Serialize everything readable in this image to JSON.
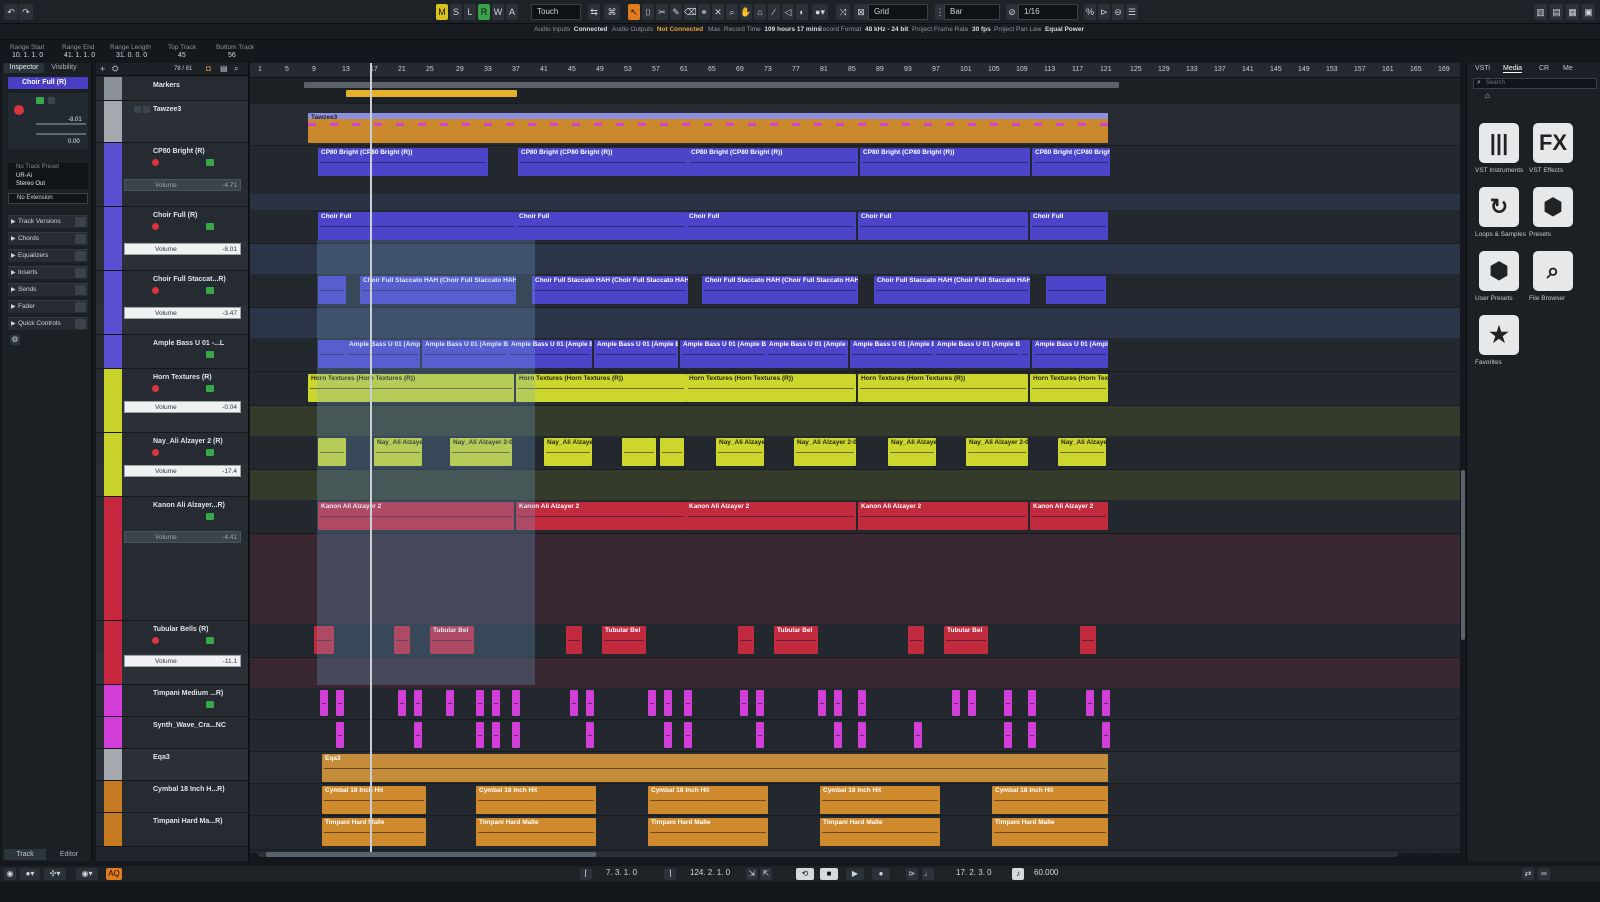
{
  "toolbar": {
    "btn_m": "M",
    "btn_s": "S",
    "btn_l": "L",
    "btn_r": "R",
    "btn_w": "W",
    "btn_a": "A",
    "automation_mode": "Touch",
    "snap_type": "Grid",
    "grid_type": "Bar",
    "quantize": "1/16"
  },
  "info": [
    {
      "label": "Audio Inputs",
      "value": "Connected",
      "warn": false
    },
    {
      "label": "Audio Outputs",
      "value": "Not Connected",
      "warn": true
    },
    {
      "label": "Max. Record Time",
      "value": "109 hours 17 mins",
      "warn": false
    },
    {
      "label": "Record Format",
      "value": "48 kHz - 24 bit",
      "warn": false
    },
    {
      "label": "Project Frame Rate",
      "value": "30 fps",
      "warn": false
    },
    {
      "label": "Project Pan Law",
      "value": "Equal Power",
      "warn": false
    }
  ],
  "range": {
    "start_label": "Range Start",
    "start": "10. 1. 1. 0",
    "end_label": "Range End",
    "end": "41. 1. 1. 0",
    "length_label": "Range Length",
    "length": "31. 0. 0. 0",
    "top_label": "Top Track",
    "top": "45",
    "bottom_label": "Bottom Track",
    "bottom": "56"
  },
  "inspector": {
    "tab_inspector": "Inspector",
    "tab_visibility": "Visibility",
    "track_name": "Choir Full (R)",
    "value1": "-8.01",
    "value2": "0.00",
    "no_preset": "No Track Preset",
    "input": "UR-Ai",
    "output": "Stereo Out",
    "extension": "No Extension",
    "sections": [
      "Track Versions",
      "Chords",
      "Equalizers",
      "Inserts",
      "Sends",
      "Fader",
      "Quick Controls"
    ]
  },
  "tracklist": {
    "count": "78 / 81",
    "tracks": [
      {
        "name": "Markers",
        "sub": "",
        "vol": ""
      },
      {
        "name": "Tawzee3",
        "sub": "",
        "vol": ""
      },
      {
        "name": "CP80 Bright (R)",
        "sub": "Volume",
        "vol": "-4.71"
      },
      {
        "name": "Choir Full (R)",
        "sub": "Volume",
        "vol": "-8.01"
      },
      {
        "name": "Choir Full Staccat...R)",
        "sub": "Volume",
        "vol": "-3.47"
      },
      {
        "name": "Ample Bass U 01 -...L",
        "sub": "",
        "vol": ""
      },
      {
        "name": "Horn Textures (R)",
        "sub": "Volume",
        "vol": "-0.04"
      },
      {
        "name": "Nay_Ali Alzayer 2 (R)",
        "sub": "Volume",
        "vol": "-17.4"
      },
      {
        "name": "Kanon Ali Alzayer...R)",
        "sub": "Volume",
        "vol": "-4.41"
      },
      {
        "name": "Tubular Bells (R)",
        "sub": "Volume",
        "vol": "-11.1"
      },
      {
        "name": "Timpani Medium ...R)",
        "sub": "",
        "vol": ""
      },
      {
        "name": "Synth_Wave_Cra...NC",
        "sub": "",
        "vol": ""
      },
      {
        "name": "Eqa3",
        "sub": "",
        "vol": ""
      },
      {
        "name": "Cymbal 18 Inch H...R)",
        "sub": "",
        "vol": ""
      },
      {
        "name": "Timpani Hard Ma...R)",
        "sub": "",
        "vol": ""
      }
    ]
  },
  "ruler": [
    "1",
    "5",
    "9",
    "13",
    "17",
    "21",
    "25",
    "29",
    "33",
    "37",
    "41",
    "45",
    "49",
    "53",
    "57",
    "61",
    "65",
    "69",
    "73",
    "77",
    "81",
    "85",
    "89",
    "93",
    "97",
    "101",
    "105",
    "109",
    "113",
    "117",
    "121",
    "125",
    "129",
    "133",
    "137",
    "141",
    "145",
    "149",
    "153",
    "157",
    "161",
    "165",
    "169"
  ],
  "events": {
    "tawzee": "Tawzee3",
    "cp80": "CP80 Bright (CP80 Bright (R))",
    "choir": "Choir Full",
    "choir_stacc": "Choir Full Staccato HAH (Choir Full Staccato HAH (R))",
    "bass": "Ample Bass U 01 (Ample Bass",
    "horn": "Horn Textures (Horn Textures (R))",
    "nay": "Nay_Ali Alzayer 2-01",
    "kanon": "Kanon Ali Alzayer 2",
    "bells": "Tubular Bel",
    "eqa": "Eqa3",
    "cymbal": "Cymbal 18 Inch Hit",
    "timpani": "Timpani Hard Malle"
  },
  "rightpanel": {
    "tabs": [
      "VSTi",
      "Media",
      "CR",
      "Me"
    ],
    "search_placeholder": "Search",
    "items": [
      {
        "label": "VST Instruments",
        "icon": "piano-icon",
        "glyph": "|||"
      },
      {
        "label": "VST Effects",
        "icon": "fx-icon",
        "glyph": "FX"
      },
      {
        "label": "Loops & Samples",
        "icon": "loop-icon",
        "glyph": "↻"
      },
      {
        "label": "Presets",
        "icon": "presets-icon",
        "glyph": "⬢"
      },
      {
        "label": "User Presets",
        "icon": "user-presets-icon",
        "glyph": "⬢"
      },
      {
        "label": "File Browser",
        "icon": "file-browser-icon",
        "glyph": "⌕"
      },
      {
        "label": "Favorites",
        "icon": "star-icon",
        "glyph": "★"
      }
    ]
  },
  "transport": {
    "left_locator": "7. 3. 1. 0",
    "right_locator": "124. 2. 1. 0",
    "position": "17. 2. 3. 0",
    "tempo": "60.000",
    "track_tab": "Track",
    "editor_tab": "Editor",
    "aq": "AQ"
  }
}
